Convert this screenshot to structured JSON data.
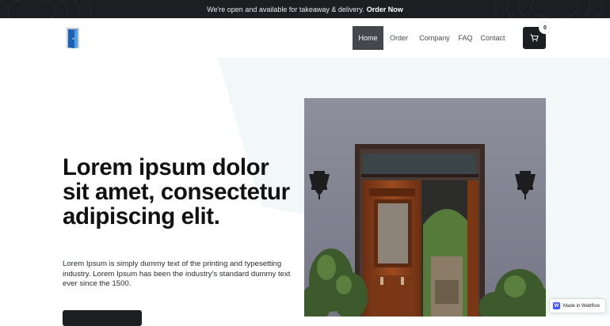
{
  "announcement": {
    "text": "We're open and available for takeaway & delivery.",
    "link": "Order Now"
  },
  "nav": {
    "logo_icon": "door-logo-icon",
    "items": [
      {
        "label": "Home",
        "active": true
      },
      {
        "label": "Order",
        "active": false
      },
      {
        "label": "Company",
        "active": false
      },
      {
        "label": "FAQ",
        "active": false
      },
      {
        "label": "Contact",
        "active": false
      }
    ],
    "cart_icon": "cart-icon",
    "cart_count": "0"
  },
  "hero": {
    "title": "Lorem ipsum dolor sit amet, consectetur adipiscing elit.",
    "text": "Lorem Ipsum is simply dummy text of the printing and typesetting industry. Lorem Ipsum has been the industry's standard dummy text ever since the 1500."
  },
  "badge": {
    "label": "Made in Webflow",
    "icon": "W"
  },
  "colors": {
    "dark": "#1c1e22",
    "active_nav": "#45474d",
    "hero_tint": "#f1f8f7",
    "webflow_blue": "#4353ff"
  }
}
